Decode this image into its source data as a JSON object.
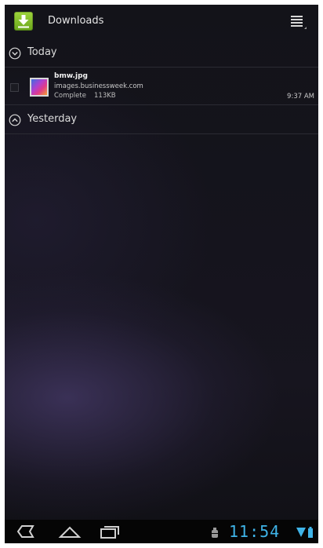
{
  "app": {
    "title": "Downloads"
  },
  "sections": [
    {
      "label": "Today",
      "expanded": true
    },
    {
      "label": "Yesterday",
      "expanded": false
    }
  ],
  "downloads": [
    {
      "name": "bmw.jpg",
      "source": "images.businessweek.com",
      "status": "Complete",
      "size": "113KB",
      "time": "9:37 AM"
    }
  ],
  "status_bar": {
    "clock": "11:54"
  },
  "icons": {
    "app": "download-icon",
    "sort": "sort-menu-icon",
    "back": "back-icon",
    "home": "home-icon",
    "recents": "recent-apps-icon",
    "usb": "usb-debug-icon",
    "wifi": "wifi-icon",
    "battery": "battery-icon"
  },
  "colors": {
    "accent": "#3fb4e8",
    "app_icon": "#7cbf26"
  }
}
